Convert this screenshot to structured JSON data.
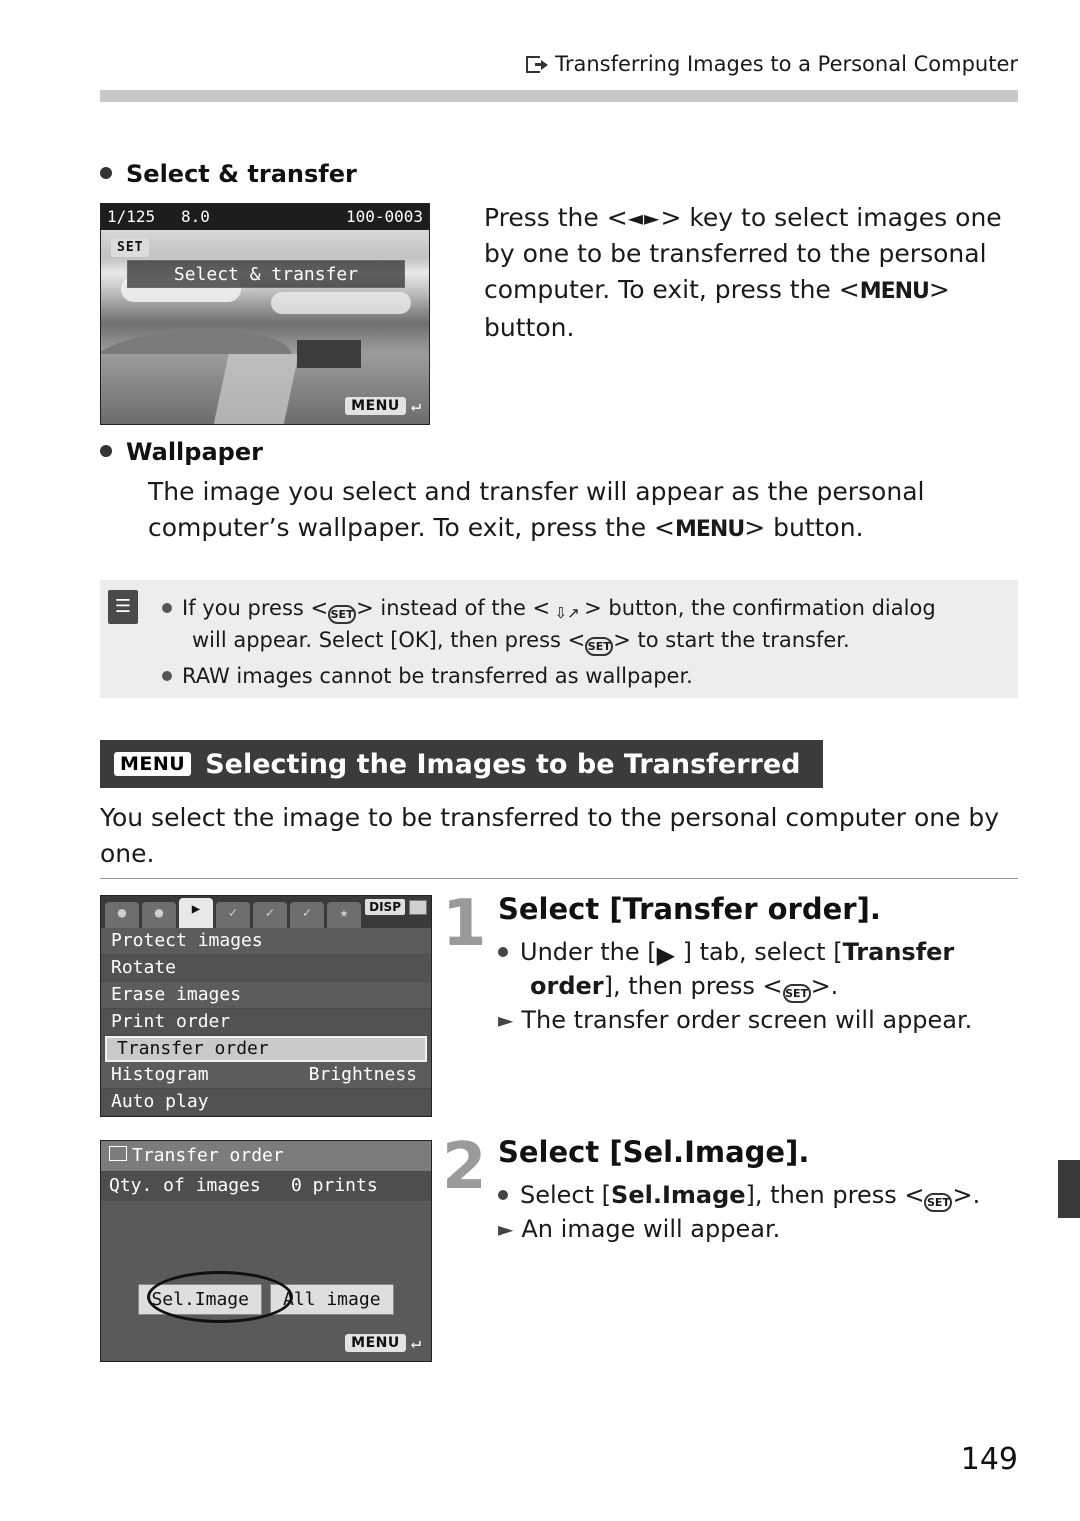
{
  "header": {
    "title": "Transferring Images to a Personal Computer",
    "icon": "transfer-icon"
  },
  "section_select_transfer": {
    "heading": "Select & transfer",
    "paragraph_1": "Press the <",
    "paragraph_arrow": "◄►",
    "paragraph_2": "> key to select images one by one to be transferred to the personal computer. To exit, press the <",
    "menu_label": "MENU",
    "paragraph_3": "> button."
  },
  "lcd_select_transfer": {
    "shutter": "1/125",
    "aperture": "8.0",
    "file_number": "100-0003",
    "set_badge": "SET",
    "overlay_title": "Select & transfer",
    "menu_badge": "MENU",
    "return_glyph": "↵"
  },
  "section_wallpaper": {
    "heading": "Wallpaper",
    "line_1": "The image you select and transfer will appear as the personal",
    "line_2a": "computer’s wallpaper. To exit, press the <",
    "menu_label": "MENU",
    "line_2b": "> button."
  },
  "note_box": {
    "icon": "note-icon",
    "item_1_a": "If you press <",
    "item_1_set": "SET",
    "item_1_b": "> instead of the <",
    "item_1_dl": "direct-transfer",
    "item_1_c": "> button, the confirmation dialog",
    "item_1_d": "will appear. Select [OK], then press <",
    "item_1_e": "> to start the transfer.",
    "item_2": "RAW images cannot be transferred as wallpaper."
  },
  "section_title": {
    "badge": "MENU",
    "text": "Selecting the Images to be Transferred"
  },
  "intro": "You select the image to be transferred to the personal computer one by one.",
  "lcd_menu": {
    "tabs": [
      "shoot1",
      "shoot2",
      "playback",
      "setup1",
      "setup2",
      "setup3",
      "mymenu"
    ],
    "selected_tab_index": 2,
    "disp_badge": "DISP",
    "rows": [
      {
        "label": "Protect images",
        "value": ""
      },
      {
        "label": "Rotate",
        "value": ""
      },
      {
        "label": "Erase images",
        "value": ""
      },
      {
        "label": "Print order",
        "value": ""
      },
      {
        "label": "Transfer order",
        "value": "",
        "highlight": true
      },
      {
        "label": "Histogram",
        "value": "Brightness"
      },
      {
        "label": "Auto play",
        "value": ""
      }
    ]
  },
  "lcd_transfer_order": {
    "title": "Transfer order",
    "qty_label": "Qty. of images",
    "qty_value": "0 prints",
    "button_sel_image": "Sel.Image",
    "button_all_image": "All image",
    "menu_badge": "MENU",
    "return_glyph": "↵"
  },
  "step1": {
    "number": "1",
    "heading": "Select [Transfer order].",
    "line_1a": "Under the [",
    "line_1b": "] tab, select [",
    "bold_transfer": "Transfer",
    "bold_order": "order",
    "line_1c": "], then press <",
    "line_1d": ">.",
    "line_2": "The transfer order screen will appear."
  },
  "step2": {
    "number": "2",
    "heading": "Select [Sel.Image].",
    "line_1a": "Select [",
    "bold_sel_image": "Sel.Image",
    "line_1b": "], then press <",
    "line_1c": ">.",
    "line_2": "An image will appear."
  },
  "page_number": "149",
  "colors": {
    "rule": "#c8c8c8",
    "note_bg": "#ededed",
    "title_bar": "#3b3b3b",
    "step_number": "#9a9a9a"
  }
}
